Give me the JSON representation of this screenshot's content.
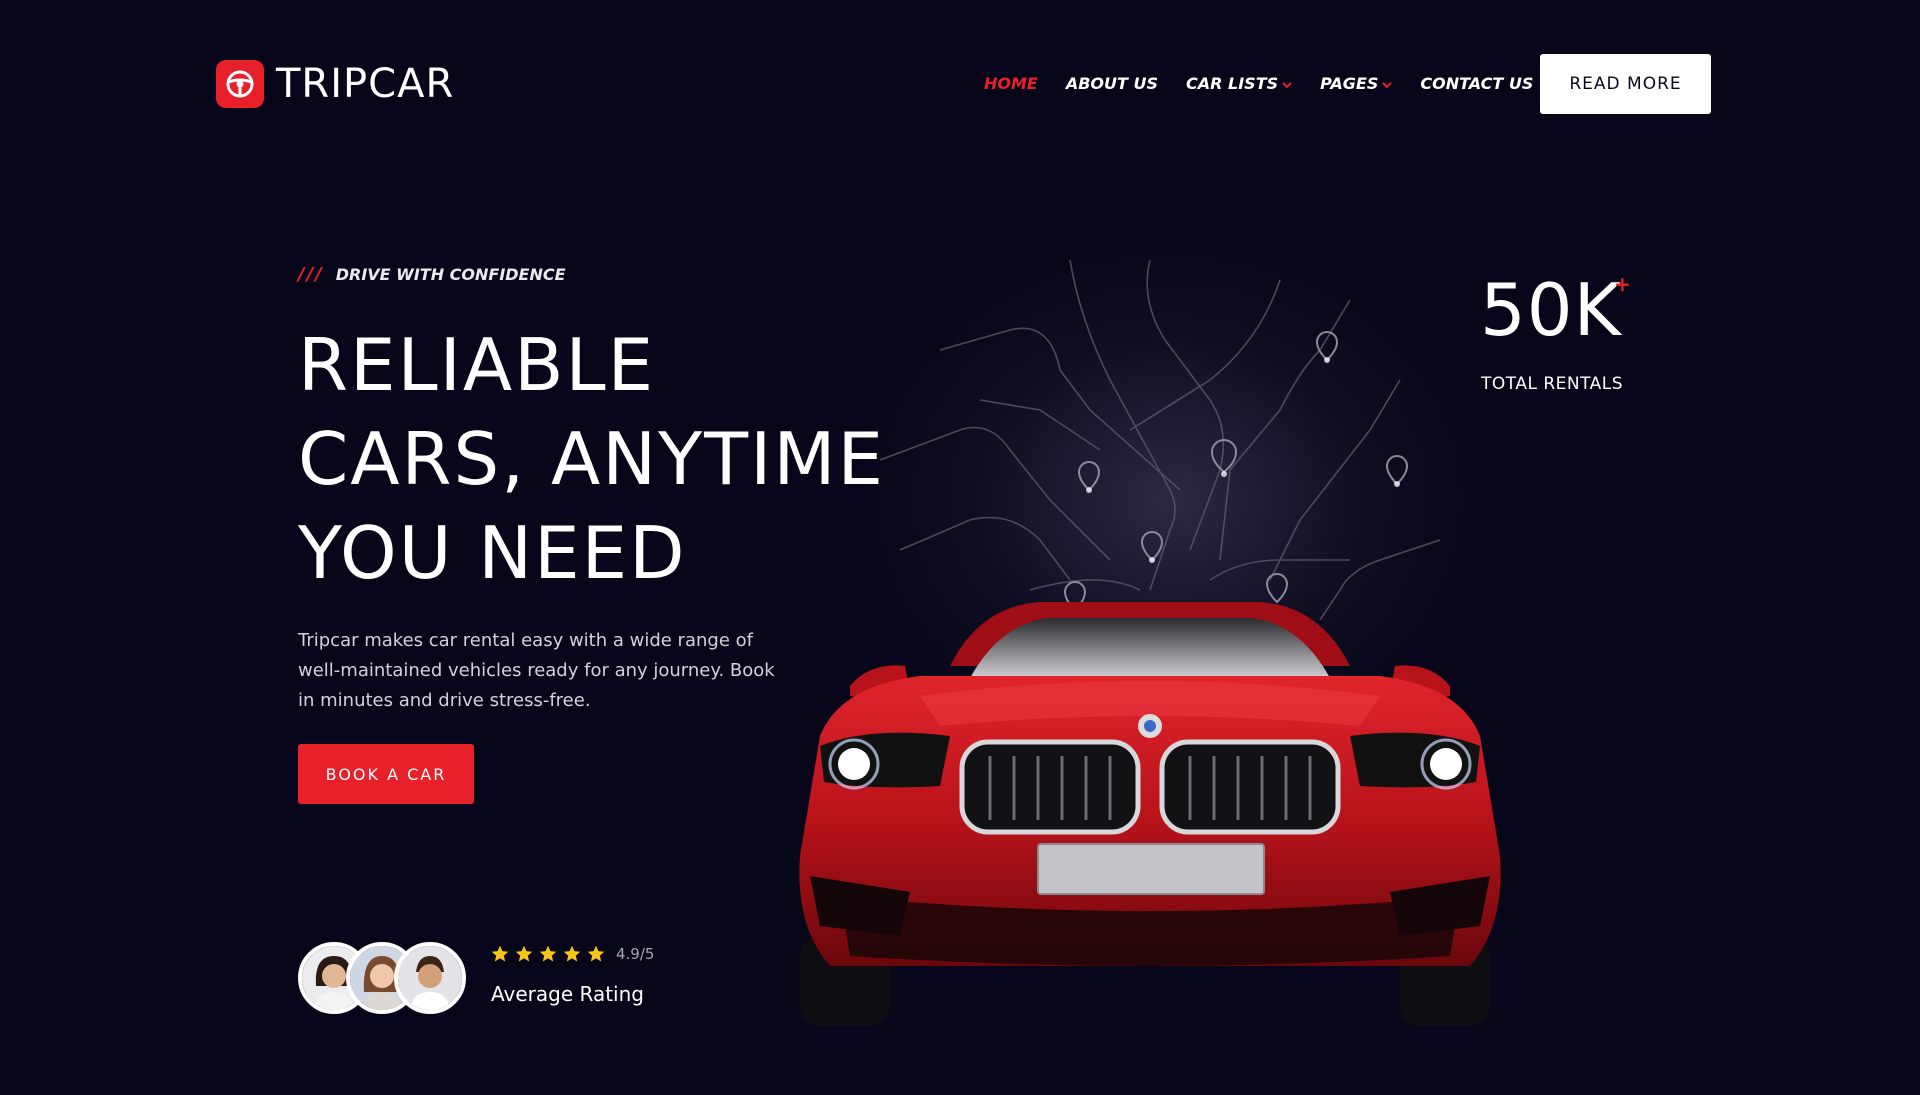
{
  "brand": {
    "name": "TRIPCAR",
    "color": "#e8202a",
    "icon": "steering-wheel-icon"
  },
  "nav": {
    "items": [
      {
        "label": "HOME",
        "active": true,
        "dropdown": false
      },
      {
        "label": "ABOUT US",
        "active": false,
        "dropdown": false
      },
      {
        "label": "CAR LISTS",
        "active": false,
        "dropdown": true
      },
      {
        "label": "PAGES",
        "active": false,
        "dropdown": true
      },
      {
        "label": "CONTACT US",
        "active": false,
        "dropdown": false
      }
    ],
    "cta_label": "READ MORE"
  },
  "hero": {
    "tagline_mark": "///",
    "tagline": "DRIVE WITH CONFIDENCE",
    "headline": [
      "RELIABLE",
      "CARS, ANYTIME",
      "YOU NEED"
    ],
    "description": "Tripcar makes car rental easy with a wide range of well-maintained vehicles ready for any journey. Book in minutes and drive stress-free.",
    "button_label": "BOOK A CAR"
  },
  "rating": {
    "stars": 5,
    "value": "4.9/5",
    "label": "Average Rating",
    "star_color": "#f5c518"
  },
  "stat": {
    "value": "50K",
    "suffix": "+",
    "label": "TOTAL RENTALS"
  },
  "colors": {
    "background": "#07061a",
    "accent": "#e8202a",
    "car": "#c8141c"
  }
}
